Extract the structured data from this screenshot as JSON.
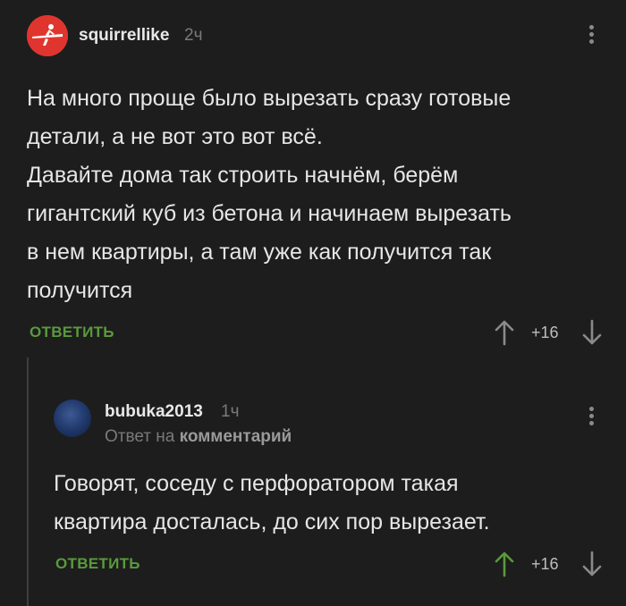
{
  "comment1": {
    "username": "squirrellike",
    "time": "2ч",
    "lines": [
      "На много проще было вырезать сразу готовые",
      "детали, а не вот это вот всё.",
      "Давайте дома так строить начнём, берём",
      "гигантский куб из бетона и начинаем вырезать",
      "в нем квартиры, а там уже как получится так",
      "получится"
    ],
    "reply_label": "ОТВЕТИТЬ",
    "score": "+16",
    "avatar_icon": "surfer-on-red-icon",
    "upvote_color": "#8a8a8a"
  },
  "comment2": {
    "username": "bubuka2013",
    "time": "1ч",
    "reply_to_prefix": "Ответ на",
    "reply_to_link": "комментарий",
    "lines": [
      "Говорят, соседу с перфоратором такая",
      "квартира досталась, до сих пор вырезает."
    ],
    "reply_label": "ОТВЕТИТЬ",
    "score": "+16",
    "upvote_color": "#5a9a3c"
  },
  "colors": {
    "background": "#1d1d1d",
    "accent_green": "#5a9a3c",
    "text": "#e6e6e6",
    "muted": "#7a7a7a"
  }
}
